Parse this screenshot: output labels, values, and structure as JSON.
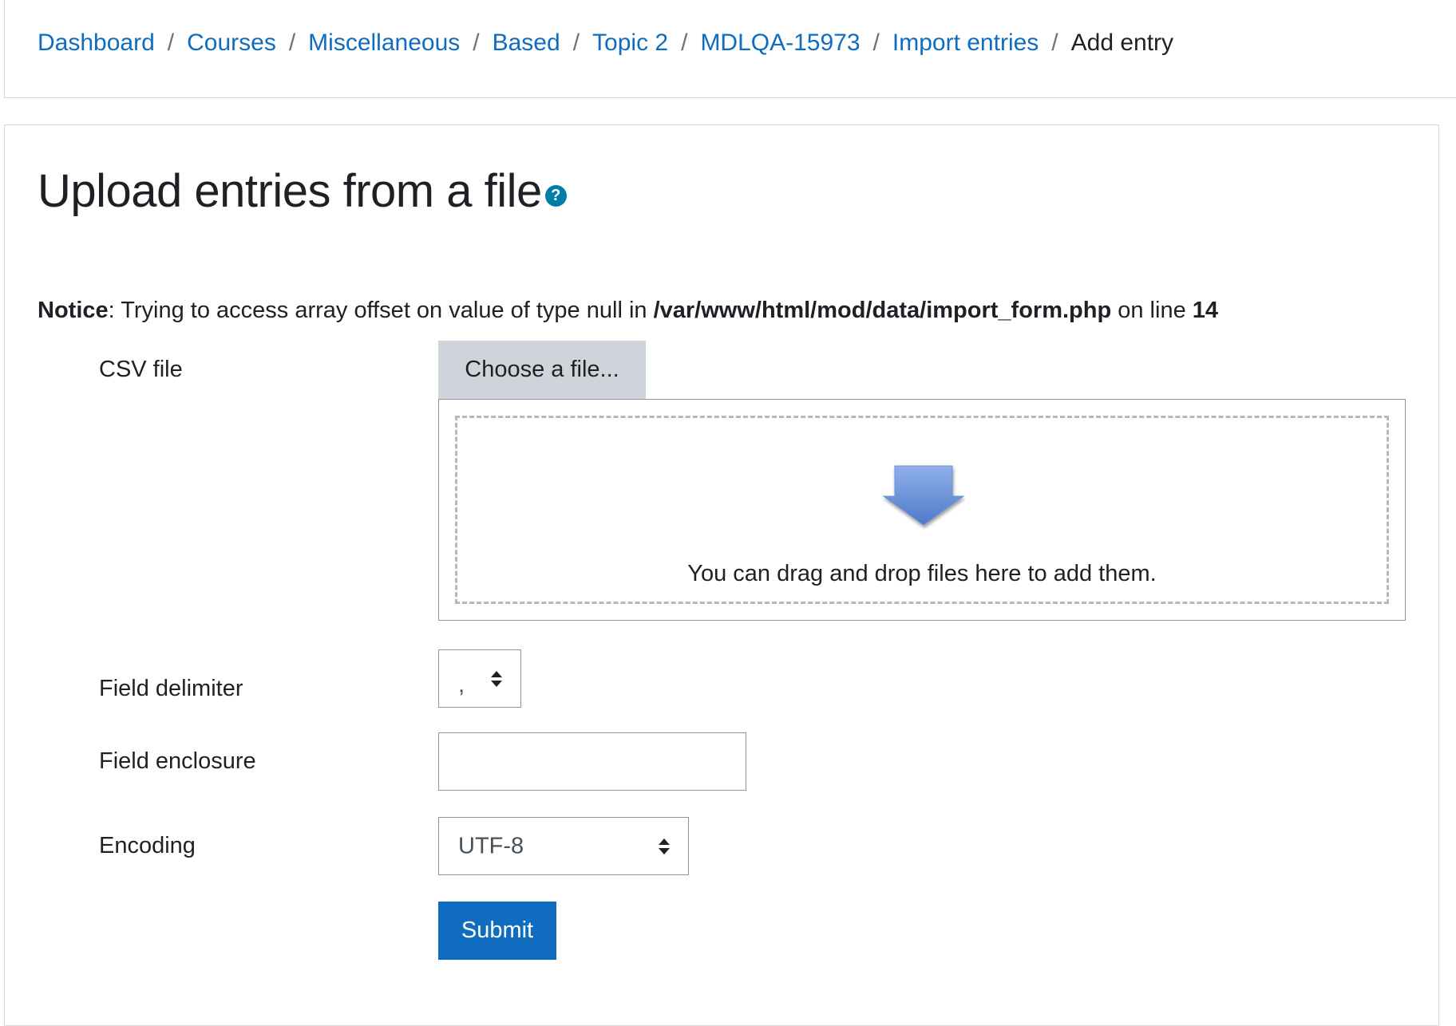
{
  "breadcrumb": {
    "items": [
      {
        "label": "Dashboard"
      },
      {
        "label": "Courses"
      },
      {
        "label": "Miscellaneous"
      },
      {
        "label": "Based"
      },
      {
        "label": "Topic 2"
      },
      {
        "label": "MDLQA-15973"
      },
      {
        "label": "Import entries"
      }
    ],
    "separator": "/",
    "current": "Add entry"
  },
  "page": {
    "title": "Upload entries from a file",
    "help_icon": "question-circle-icon",
    "help_glyph": "?"
  },
  "notice": {
    "label": "Notice",
    "pre": ": Trying to access array offset on value of type null in ",
    "path": "/var/www/html/mod/data/import_form.php",
    "mid": " on line ",
    "line": "14"
  },
  "form": {
    "csv_file": {
      "label": "CSV file",
      "choose_button": "Choose a file...",
      "drop_text": "You can drag and drop files here to add them.",
      "drop_icon": "down-arrow-icon"
    },
    "field_delimiter": {
      "label": "Field delimiter",
      "value": ","
    },
    "field_enclosure": {
      "label": "Field enclosure",
      "value": ""
    },
    "encoding": {
      "label": "Encoding",
      "value": "UTF-8"
    },
    "submit_label": "Submit"
  },
  "colors": {
    "link": "#0f6cbf",
    "primary_button": "#0f6cbf",
    "secondary_button": "#ced4da",
    "help_icon": "#007eaa",
    "drop_arrow": "#5b86d2"
  }
}
